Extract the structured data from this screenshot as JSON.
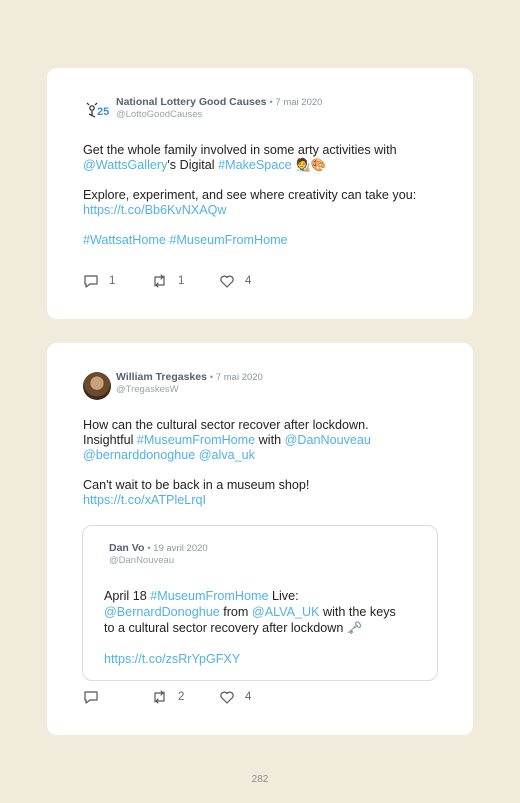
{
  "tweets": [
    {
      "author": "National Lottery Good Causes",
      "date": "• 7 mai 2020",
      "handle": "@LottoGoodCauses",
      "logo_text": "25",
      "lines": {
        "l1": "Get the whole family involved in some arty activities with",
        "l2_link1": "@WattsGallery",
        "l2_text": "'s Digital ",
        "l2_link2": "#MakeSpace",
        "l2_emoji": " 🧑‍🎨🎨",
        "l3": "Explore, experiment, and see where creativity can take you:",
        "l4_link": "https://t.co/Bb6KvNXAQw",
        "l5_link1": "#WattsatHome",
        "l5_link2": "#MuseumFromHome"
      },
      "reply_count": "1",
      "retweet_count": "1",
      "like_count": "4"
    },
    {
      "author": "William Tregaskes",
      "date": "• 7 mai 2020",
      "handle": "@TregaskesW",
      "lines": {
        "l1": "How can the cultural sector recover after lockdown.",
        "l2_text": "Insightful ",
        "l2_link1": "#MuseumFromHome",
        "l2_text2": " with ",
        "l2_link2": "@DanNouveau",
        "l3_link1": "@bernarddonoghue",
        "l3_link2": "@alva_uk",
        "l4": "Can't wait to be back in a museum shop!",
        "l5_link": "https://t.co/xATPleLrqI"
      },
      "quote": {
        "author": "Dan Vo",
        "date": "• 19 avril 2020",
        "handle": "@DanNouveau",
        "l1_text": "April 18 ",
        "l1_link": "#MuseumFromHome",
        "l1_text2": " Live:",
        "l2_link1": "@BernardDonoghue",
        "l2_text": " from ",
        "l2_link2": "@ALVA_UK",
        "l2_text2": " with the keys",
        "l3": "to a cultural sector recovery after lockdown 🗝️",
        "l4_link": "https://t.co/zsRrYpGFXY"
      },
      "reply_count": "",
      "retweet_count": "2",
      "like_count": "4"
    }
  ],
  "page_number": "282",
  "colors": {
    "link": "#4fb2e6",
    "background": "#f1ebdb",
    "author": "#556270"
  },
  "icons": [
    "reply-icon",
    "retweet-icon",
    "like-icon"
  ]
}
